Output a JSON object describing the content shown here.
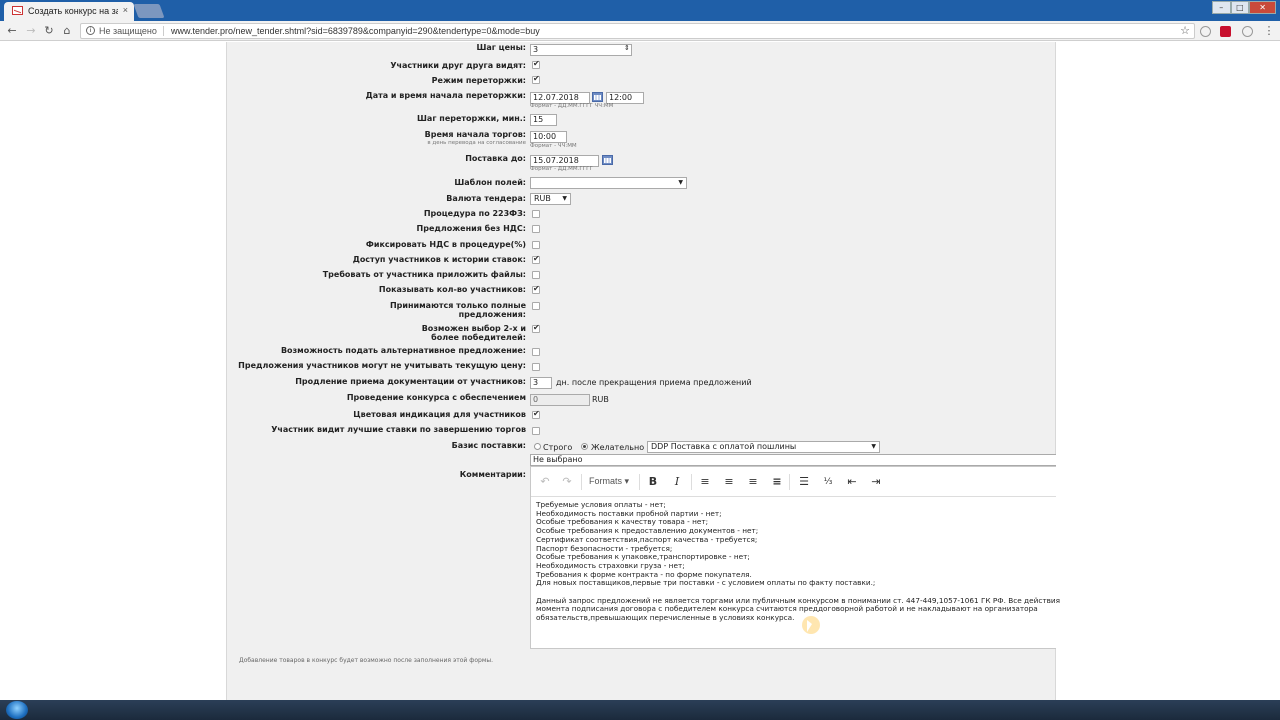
{
  "browser": {
    "tab_title": "Создать конкурс на заку",
    "tab_close": "×",
    "security_text": "Не защищено",
    "url": "www.tender.pro/new_tender.shtml?sid=6839789&companyid=290&tendertype=0&mode=buy"
  },
  "form": {
    "price_step": {
      "label": "Шаг цены:",
      "value": "3"
    },
    "participants_see": {
      "label": "Участники друг друга видят:",
      "checked": true
    },
    "rebid_mode": {
      "label": "Режим переторжки:",
      "checked": true
    },
    "rebid_start": {
      "label": "Дата и время начала переторжки:",
      "date": "12.07.2018",
      "time": "12:00",
      "hint": "Формат - ДД.ММ.ГГГГ   ЧЧ:ММ"
    },
    "rebid_step": {
      "label": "Шаг переторжки, мин.:",
      "value": "15"
    },
    "trade_start": {
      "label": "Время начала торгов:",
      "sublabel": "в день перевода на согласование",
      "value": "10:00",
      "hint": "Формат - ЧЧ:ММ"
    },
    "delivery_until": {
      "label": "Поставка до:",
      "value": "15.07.2018",
      "hint": "Формат - ДД.ММ.ГГГГ"
    },
    "fields_template": {
      "label": "Шаблон полей:",
      "value": ""
    },
    "currency": {
      "label": "Валюта тендера:",
      "value": "RUB"
    },
    "procedure_223": {
      "label": "Процедура по 223ФЗ:",
      "checked": false
    },
    "no_vat": {
      "label": "Предложения без НДС:",
      "checked": false
    },
    "fix_vat": {
      "label": "Фиксировать НДС в процедуре(%)",
      "checked": false
    },
    "bid_history": {
      "label": "Доступ участников к истории ставок:",
      "checked": true
    },
    "require_files": {
      "label": "Требовать от участника приложить файлы:",
      "checked": false
    },
    "show_count": {
      "label": "Показывать кол-во участников:",
      "checked": true
    },
    "full_only": {
      "label": "Принимаются только полные предложения:",
      "checked": false
    },
    "multi_winners": {
      "label": "Возможен выбор 2-х и более победителей:",
      "checked": true
    },
    "alternative": {
      "label": "Возможность подать альтернативное предложение:",
      "checked": false
    },
    "ignore_price": {
      "label": "Предложения участников могут не учитывать текущую цену:",
      "checked": false
    },
    "extension": {
      "label": "Продление приема документации от участников:",
      "value": "3",
      "suffix": "дн. после прекращения приема предложений"
    },
    "security": {
      "label": "Проведение конкурса с обеспечением",
      "value": "0",
      "unit": "RUB"
    },
    "color_indication": {
      "label": "Цветовая индикация для участников",
      "checked": true
    },
    "best_bids": {
      "label": "Участник видит лучшие ставки по завершению торгов",
      "checked": false
    },
    "delivery_basis": {
      "label": "Базис поставки:",
      "option_strict": "Строго",
      "option_preferred": "Желательно",
      "selected": "preferred",
      "value": "DDP Поставка с оплатой пошлины",
      "below": "Не выбрано"
    },
    "comments": {
      "label": "Комментарии:"
    }
  },
  "editor": {
    "formats_label": "Formats",
    "bold": "B",
    "italic": "I",
    "lines": [
      "Требуемые условия оплаты - нет;",
      "Необходимость поставки пробной партии - нет;",
      "Особые требования к качеству товара - нет;",
      "Особые требования к предоставлению документов - нет;",
      "Сертификат соответствия,паспорт качества - требуется;",
      "Паспорт безопасности - требуется;",
      "Особые требования к упаковке,транспортировке - нет;",
      "Необходимость страховки груза - нет;",
      "Требования к форме контракта - по форме покупателя.",
      "Для новых поставщиков,первые три поставки - с условием оплаты по факту поставки.;",
      "",
      "Данный запрос предложений не является торгами или публичным конкурсом в понимании ст. 447-449,1057-1061 ГК РФ. Все действия",
      "момента подписания договора с победителем конкурса считаются преддоговорной работой и не накладывают на организатора",
      "обязательств,превышающих перечисленные в условиях конкурса."
    ]
  },
  "footer_notice": "Добавление товаров в конкурс будет возможно после заполнения этой формы.",
  "colors": {
    "tabbar": "#1f5fa8",
    "panel": "#f0f0f0",
    "taskbar": "#1b2a3c"
  }
}
